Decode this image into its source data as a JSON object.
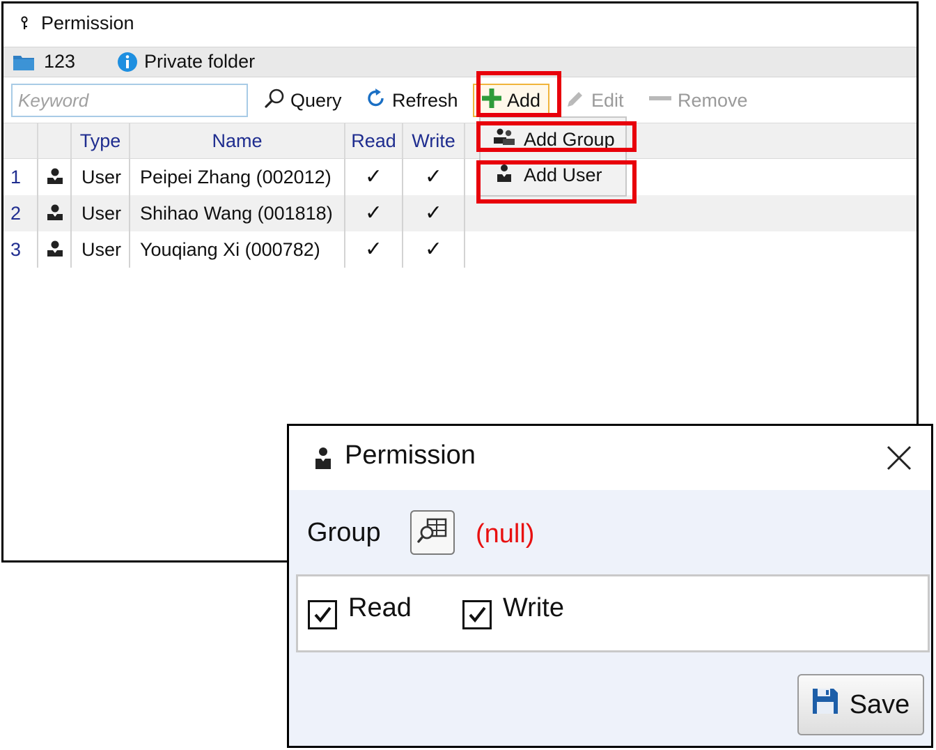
{
  "main_window": {
    "title": "Permission",
    "folder": {
      "name": "123",
      "description": "Private folder"
    },
    "toolbar": {
      "search_placeholder": "Keyword",
      "query_label": "Query",
      "refresh_label": "Refresh",
      "add_label": "Add",
      "edit_label": "Edit",
      "remove_label": "Remove"
    },
    "add_menu": {
      "items": [
        {
          "label": "Add Group"
        },
        {
          "label": "Add User"
        }
      ]
    },
    "table": {
      "columns": [
        "Type",
        "Name",
        "Read",
        "Write"
      ],
      "rows": [
        {
          "num": "1",
          "type": "User",
          "name": "Peipei Zhang (002012)",
          "read": "✓",
          "write": "✓"
        },
        {
          "num": "2",
          "type": "User",
          "name": "Shihao Wang (001818)",
          "read": "✓",
          "write": "✓"
        },
        {
          "num": "3",
          "type": "User",
          "name": "Youqiang Xi (000782)",
          "read": "✓",
          "write": "✓"
        }
      ]
    }
  },
  "dialog": {
    "title": "Permission",
    "group_label": "Group",
    "group_value": "(null)",
    "read_label": "Read",
    "read_checked": true,
    "write_label": "Write",
    "write_checked": true,
    "save_label": "Save"
  },
  "colors": {
    "highlight": "#e8000b",
    "null_text": "#e81010",
    "header_text": "#1f2d8f",
    "add_icon": "#2e9b3a"
  }
}
